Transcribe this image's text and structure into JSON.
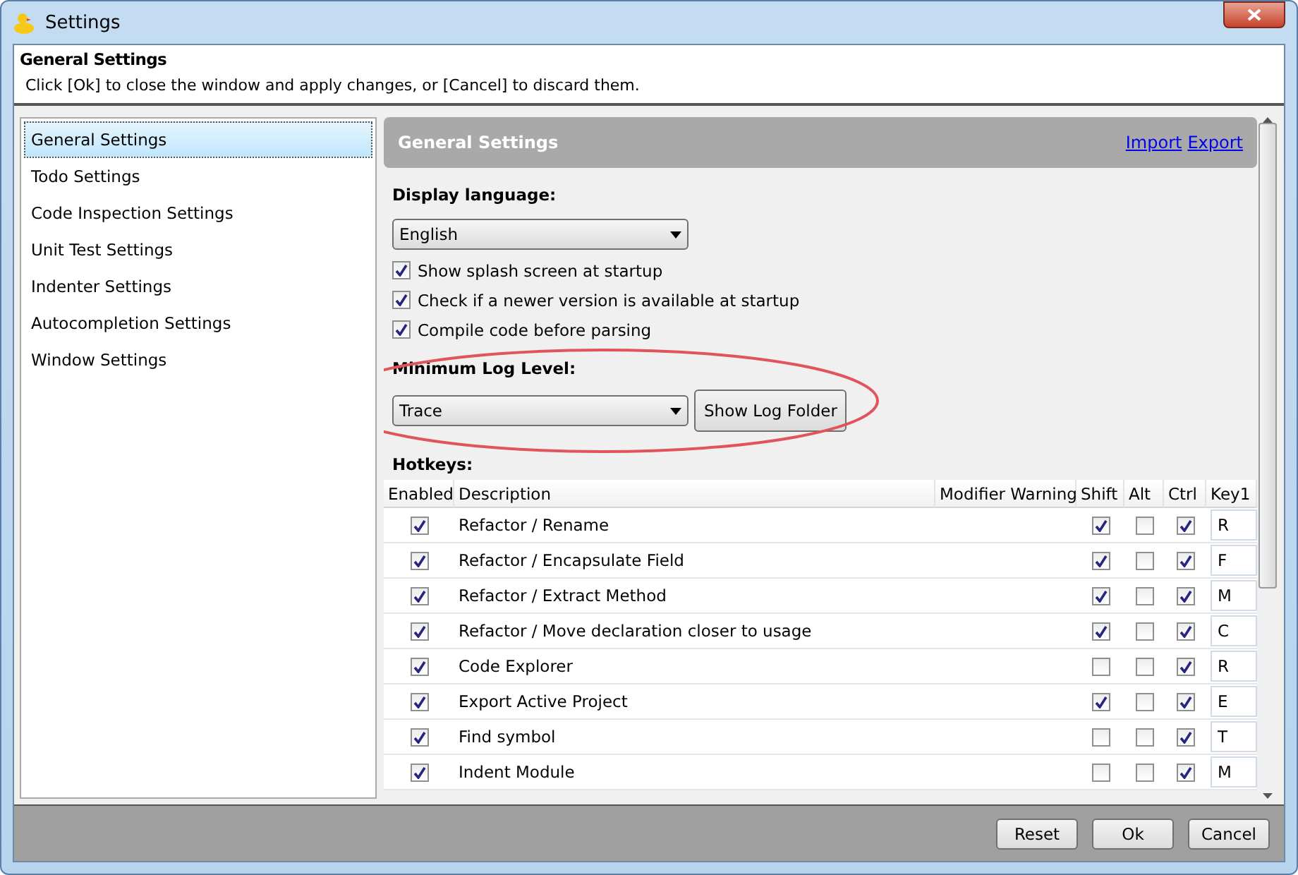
{
  "window": {
    "title": "Settings"
  },
  "header": {
    "title": "General Settings",
    "hint": "Click [Ok] to close the window and apply changes, or [Cancel] to discard them."
  },
  "sidebar": {
    "items": [
      {
        "label": "General Settings",
        "selected": true
      },
      {
        "label": "Todo Settings",
        "selected": false
      },
      {
        "label": "Code Inspection Settings",
        "selected": false
      },
      {
        "label": "Unit Test Settings",
        "selected": false
      },
      {
        "label": "Indenter Settings",
        "selected": false
      },
      {
        "label": "Autocompletion Settings",
        "selected": false
      },
      {
        "label": "Window Settings",
        "selected": false
      }
    ]
  },
  "panel": {
    "title": "General Settings",
    "links": [
      "Import",
      "Export"
    ],
    "display_language": {
      "label": "Display language:",
      "value": "English"
    },
    "options": [
      {
        "label": "Show splash screen at startup",
        "checked": true
      },
      {
        "label": "Check if a newer version is available at startup",
        "checked": true
      },
      {
        "label": "Compile code before parsing",
        "checked": true
      }
    ],
    "log_level": {
      "label": "Minimum Log Level:",
      "value": "Trace",
      "button": "Show Log Folder"
    },
    "hotkeys": {
      "label": "Hotkeys:",
      "columns": [
        "Enabled",
        "Description",
        "Modifier Warning",
        "Shift",
        "Alt",
        "Ctrl",
        "Key1"
      ],
      "rows": [
        {
          "enabled": true,
          "description": "Refactor / Rename",
          "shift": true,
          "alt": false,
          "ctrl": true,
          "key": "R"
        },
        {
          "enabled": true,
          "description": "Refactor / Encapsulate Field",
          "shift": true,
          "alt": false,
          "ctrl": true,
          "key": "F"
        },
        {
          "enabled": true,
          "description": "Refactor / Extract Method",
          "shift": true,
          "alt": false,
          "ctrl": true,
          "key": "M"
        },
        {
          "enabled": true,
          "description": "Refactor / Move declaration closer to usage",
          "shift": true,
          "alt": false,
          "ctrl": true,
          "key": "C"
        },
        {
          "enabled": true,
          "description": "Code Explorer",
          "shift": false,
          "alt": false,
          "ctrl": true,
          "key": "R"
        },
        {
          "enabled": true,
          "description": "Export Active Project",
          "shift": true,
          "alt": false,
          "ctrl": true,
          "key": "E"
        },
        {
          "enabled": true,
          "description": "Find symbol",
          "shift": false,
          "alt": false,
          "ctrl": true,
          "key": "T"
        },
        {
          "enabled": true,
          "description": "Indent Module",
          "shift": false,
          "alt": false,
          "ctrl": true,
          "key": "M"
        }
      ]
    }
  },
  "buttons": [
    "Reset",
    "Ok",
    "Cancel"
  ]
}
